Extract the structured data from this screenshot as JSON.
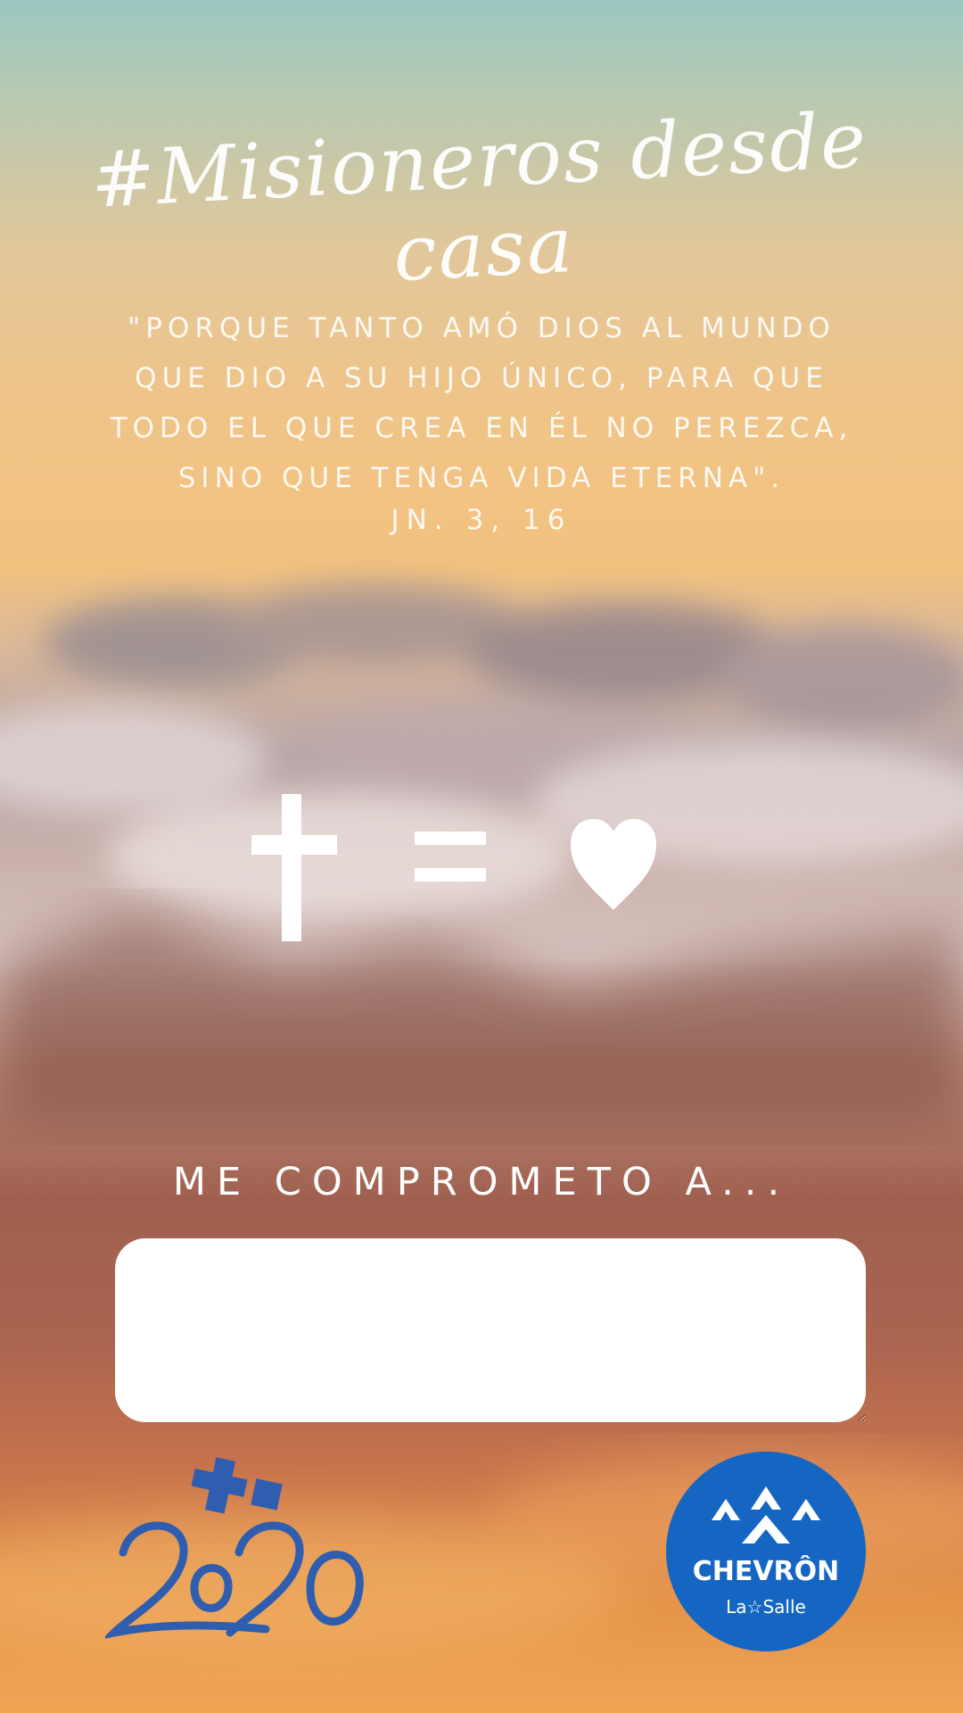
{
  "title": "#Misioneros desde casa",
  "verse": {
    "lines": [
      "\"PORQUE TANTO AMÓ DIOS AL MUNDO",
      "QUE DIO A SU HIJO ÚNICO, PARA QUE",
      "TODO EL QUE CREA EN ÉL NO PEREZCA,",
      "SINO QUE TENGA VIDA ETERNA\"."
    ],
    "reference": "JN. 3, 16"
  },
  "symbols": [
    "cross-icon",
    "equals-icon",
    "heart-icon"
  ],
  "commitment": {
    "label": "ME COMPROMETO A...",
    "value": ""
  },
  "logos": {
    "left": {
      "name": "2020-logo",
      "text": "2020",
      "color": "#2f5db0"
    },
    "right": {
      "name": "chevron-la-salle-logo",
      "text": "CHEVRÔN",
      "subtext": "La Salle",
      "color": "#1466c2"
    }
  },
  "colors": {
    "text": "#ffffff",
    "accent_blue": "#1466c2"
  }
}
